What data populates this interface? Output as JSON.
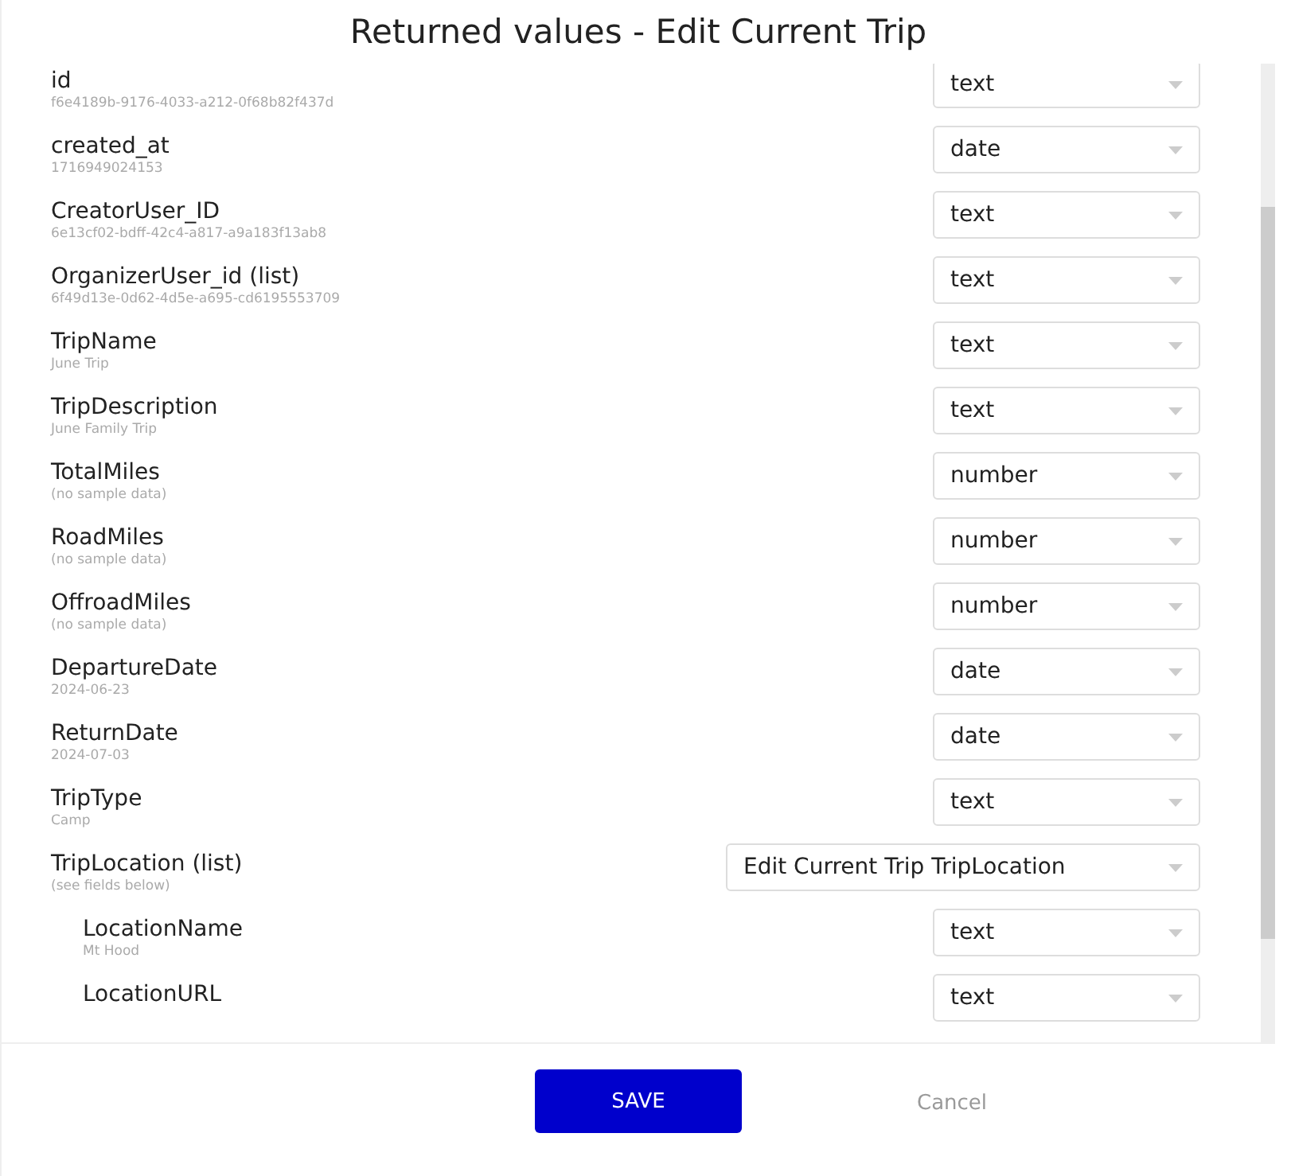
{
  "dialog": {
    "title": "Returned values - Edit Current Trip"
  },
  "fields": [
    {
      "name": "id",
      "sample": "f6e4189b-9176-4033-a212-0f68b82f437d",
      "type": "text"
    },
    {
      "name": "created_at",
      "sample": "1716949024153",
      "type": "date"
    },
    {
      "name": "CreatorUser_ID",
      "sample": "6e13cf02-bdff-42c4-a817-a9a183f13ab8",
      "type": "text"
    },
    {
      "name": "OrganizerUser_id (list)",
      "sample": "6f49d13e-0d62-4d5e-a695-cd6195553709",
      "type": "text"
    },
    {
      "name": "TripName",
      "sample": "June Trip",
      "type": "text"
    },
    {
      "name": "TripDescription",
      "sample": "June Family Trip",
      "type": "text"
    },
    {
      "name": "TotalMiles",
      "sample": "(no sample data)",
      "type": "number"
    },
    {
      "name": "RoadMiles",
      "sample": "(no sample data)",
      "type": "number"
    },
    {
      "name": "OffroadMiles",
      "sample": "(no sample data)",
      "type": "number"
    },
    {
      "name": "DepartureDate",
      "sample": "2024-06-23",
      "type": "date"
    },
    {
      "name": "ReturnDate",
      "sample": "2024-07-03",
      "type": "date"
    },
    {
      "name": "TripType",
      "sample": "Camp",
      "type": "text"
    },
    {
      "name": "TripLocation (list)",
      "sample": "(see fields below)",
      "type": "Edit Current Trip TripLocation",
      "children": [
        {
          "name": "LocationName",
          "sample": "Mt Hood",
          "type": "text"
        },
        {
          "name": "LocationURL",
          "type": "text"
        }
      ]
    }
  ],
  "buttons": {
    "save": "SAVE",
    "cancel": "Cancel"
  }
}
